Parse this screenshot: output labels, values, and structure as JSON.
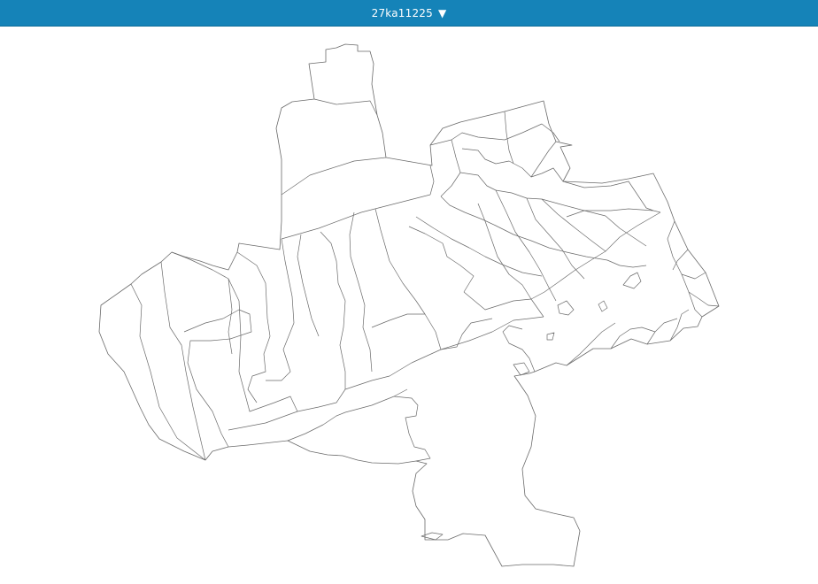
{
  "header": {
    "selector_value": "27ka11225",
    "caret": "▼"
  },
  "colors": {
    "header_bg": "#1583b8",
    "header_text": "#ffffff",
    "boundary_stroke": "#6a6a6a",
    "map_fill": "#ffffff"
  },
  "icons": {
    "dropdown": "chevron-down-icon"
  }
}
